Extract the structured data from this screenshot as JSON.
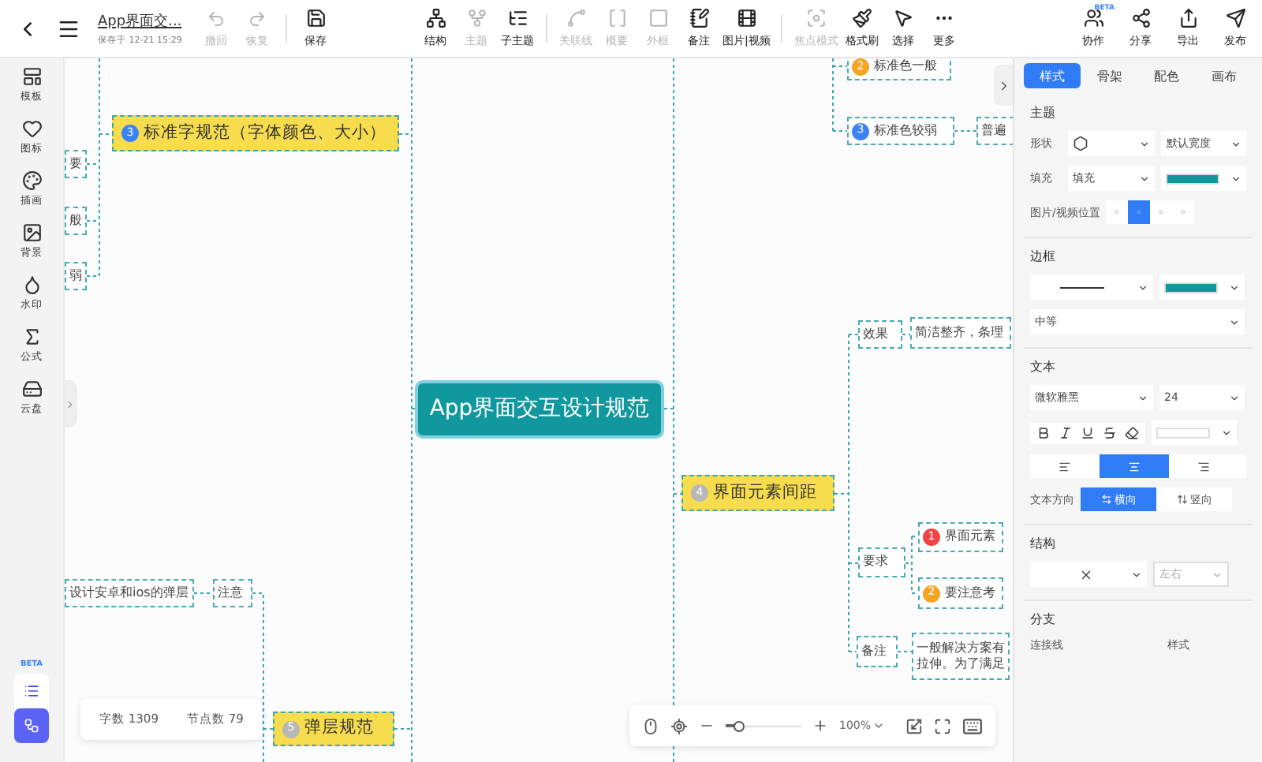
{
  "toolbar": {
    "title": "App界面交...",
    "saved": "保存于 12-21 15:29",
    "history": [
      {
        "label": "撤回",
        "disabled": true
      },
      {
        "label": "恢复",
        "disabled": true
      }
    ],
    "save": "保存",
    "tools": [
      {
        "label": "结构",
        "disabled": false
      },
      {
        "label": "主题",
        "disabled": true
      },
      {
        "label": "子主题",
        "disabled": false
      },
      {
        "label": "关联线",
        "disabled": true
      },
      {
        "label": "概要",
        "disabled": true
      },
      {
        "label": "外框",
        "disabled": true
      },
      {
        "label": "备注",
        "disabled": false
      },
      {
        "label": "图片|视频",
        "disabled": false
      },
      {
        "label": "焦点模式",
        "disabled": true
      },
      {
        "label": "格式刷",
        "disabled": false
      },
      {
        "label": "选择",
        "disabled": false
      },
      {
        "label": "更多",
        "disabled": false
      }
    ],
    "actions": [
      {
        "label": "协作",
        "badge": "BETA"
      },
      {
        "label": "分享"
      },
      {
        "label": "导出"
      },
      {
        "label": "发布"
      }
    ]
  },
  "sidebar": {
    "items": [
      {
        "label": "模板"
      },
      {
        "label": "图标"
      },
      {
        "label": "插画"
      },
      {
        "label": "背景"
      },
      {
        "label": "水印"
      },
      {
        "label": "公式"
      },
      {
        "label": "云盘"
      }
    ],
    "beta": "BETA",
    "views": [
      {
        "selected": false
      },
      {
        "selected": true
      }
    ]
  },
  "canvas": {
    "nodes": [
      {
        "kind": "sub",
        "text": "标准色一般",
        "badge": "2",
        "color": "#f5a524"
      },
      {
        "kind": "topic",
        "text": "标准字规范（字体颜色、大小）",
        "badge": "3",
        "color": "#3b82f6"
      },
      {
        "kind": "sub",
        "text": "标准色较弱",
        "badge": "3",
        "color": "#3b82f6"
      },
      {
        "kind": "sub",
        "text": "普遍"
      },
      {
        "kind": "sub",
        "text": "要"
      },
      {
        "kind": "sub",
        "text": "般"
      },
      {
        "kind": "sub",
        "text": "弱"
      },
      {
        "kind": "sub",
        "text": "效果"
      },
      {
        "kind": "sub",
        "text": "简洁整齐，条理"
      },
      {
        "kind": "main",
        "text": "App界面交互设计规范"
      },
      {
        "kind": "topic",
        "text": "界面元素间距",
        "badge": "4",
        "color": "#b8b8b8"
      },
      {
        "kind": "sub",
        "text": "要求"
      },
      {
        "kind": "sub",
        "text": "界面元素",
        "badge": "1",
        "color": "#ef4444"
      },
      {
        "kind": "sub",
        "text": "设计安卓和ios的弹层"
      },
      {
        "kind": "sub",
        "text": "注意"
      },
      {
        "kind": "sub",
        "text": "要注意考",
        "badge": "2",
        "color": "#f5a524"
      },
      {
        "kind": "sub",
        "text": "备注"
      },
      {
        "kind": "sub",
        "text": "一般解决方案有拉伸。为了满足"
      },
      {
        "kind": "topic",
        "text": "弹层规范",
        "badge": "5",
        "color": "#b8b8b8"
      }
    ],
    "stats": [
      "字数 1309",
      "节点数 79"
    ],
    "zoom": {
      "level": 0.17,
      "reading": "100%"
    }
  },
  "panel": {
    "tabs": [
      {
        "label": "样式",
        "selected": true
      },
      {
        "label": "骨架",
        "selected": false
      },
      {
        "label": "配色",
        "selected": false
      },
      {
        "label": "画布",
        "selected": false
      }
    ],
    "theme": {
      "title": "主题",
      "shape_label": "形状",
      "width": "默认宽度",
      "fill_label": "填充",
      "fill": "填充",
      "media_label": "图片/视频位置",
      "media_positions": [
        {
          "selected": false
        },
        {
          "selected": true
        },
        {
          "selected": false
        },
        {
          "selected": false
        }
      ]
    },
    "border": {
      "title": "边框",
      "weight": "中等"
    },
    "text": {
      "title": "文本",
      "font": "微软雅黑",
      "size": "24",
      "align": [
        {
          "selected": false
        },
        {
          "selected": true
        },
        {
          "selected": false
        }
      ],
      "direction_label": "文本方向",
      "directions": [
        {
          "label": "横向",
          "selected": true
        },
        {
          "label": "竖向",
          "selected": false
        }
      ]
    },
    "structure": {
      "title": "结构",
      "layout": "左右",
      "layout_disabled": true
    },
    "branch": {
      "title": "分支",
      "labels": [
        "连接线",
        "样式"
      ]
    }
  }
}
